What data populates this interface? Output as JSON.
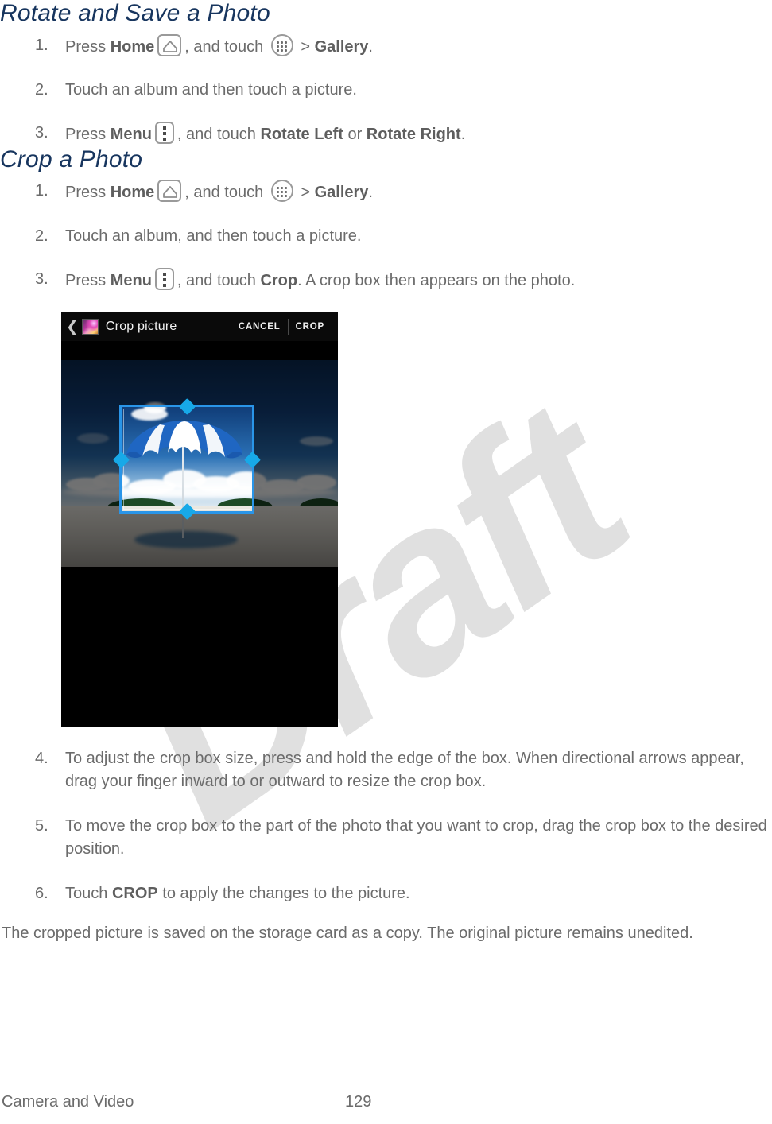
{
  "document": {
    "sections": [
      {
        "heading": "Rotate and Save a Photo",
        "steps": [
          {
            "num": "1.",
            "parts": [
              {
                "t": "text",
                "v": "Press "
              },
              {
                "t": "bold",
                "v": "Home"
              },
              {
                "t": "icon",
                "v": "home-icon"
              },
              {
                "t": "text",
                "v": ", and touch "
              },
              {
                "t": "icon",
                "v": "apps-grid-icon"
              },
              {
                "t": "text",
                "v": " > "
              },
              {
                "t": "bold",
                "v": "Gallery"
              },
              {
                "t": "text",
                "v": "."
              }
            ]
          },
          {
            "num": "2.",
            "parts": [
              {
                "t": "text",
                "v": "Touch an album and then touch a picture."
              }
            ]
          },
          {
            "num": "3.",
            "parts": [
              {
                "t": "text",
                "v": "Press "
              },
              {
                "t": "bold",
                "v": "Menu"
              },
              {
                "t": "icon",
                "v": "menu-overflow-icon"
              },
              {
                "t": "text",
                "v": ", and touch "
              },
              {
                "t": "bold",
                "v": "Rotate Left"
              },
              {
                "t": "text",
                "v": " or "
              },
              {
                "t": "bold",
                "v": "Rotate Right"
              },
              {
                "t": "text",
                "v": "."
              }
            ]
          }
        ]
      },
      {
        "heading": "Crop a Photo",
        "steps": [
          {
            "num": "1.",
            "parts": [
              {
                "t": "text",
                "v": "Press "
              },
              {
                "t": "bold",
                "v": "Home"
              },
              {
                "t": "icon",
                "v": "home-icon"
              },
              {
                "t": "text",
                "v": ", and touch "
              },
              {
                "t": "icon",
                "v": "apps-grid-icon"
              },
              {
                "t": "text",
                "v": " > "
              },
              {
                "t": "bold",
                "v": "Gallery"
              },
              {
                "t": "text",
                "v": "."
              }
            ]
          },
          {
            "num": "2.",
            "parts": [
              {
                "t": "text",
                "v": "Touch an album, and then touch a picture."
              }
            ]
          },
          {
            "num": "3.",
            "parts": [
              {
                "t": "text",
                "v": "Press "
              },
              {
                "t": "bold",
                "v": "Menu"
              },
              {
                "t": "icon",
                "v": "menu-overflow-icon"
              },
              {
                "t": "text",
                "v": ", and touch "
              },
              {
                "t": "bold",
                "v": "Crop"
              },
              {
                "t": "text",
                "v": ". A crop box then appears on the photo."
              }
            ]
          }
        ]
      }
    ],
    "steps_after_figure": [
      {
        "num": "4.",
        "parts": [
          {
            "t": "text",
            "v": "To adjust the crop box size, press and hold the edge of the box. When directional arrows appear, drag your finger inward to or outward to resize the crop box."
          }
        ]
      },
      {
        "num": "5.",
        "parts": [
          {
            "t": "text",
            "v": "To move the crop box to the part of the photo that you want to crop, drag the crop box to the desired position."
          }
        ]
      },
      {
        "num": "6.",
        "parts": [
          {
            "t": "text",
            "v": "Touch "
          },
          {
            "t": "bold",
            "v": "CROP"
          },
          {
            "t": "text",
            "v": " to apply the changes to the picture."
          }
        ]
      }
    ],
    "closing_paragraph": "The cropped picture is saved on the storage card as a copy. The original picture remains unedited."
  },
  "figure": {
    "alt": "Android Gallery crop picture screen",
    "actionbar": {
      "back_icon": "back-chevron-icon",
      "app_icon": "gallery-app-icon",
      "title": "Crop picture",
      "cancel_label": "CANCEL",
      "crop_label": "CROP"
    },
    "photo": {
      "description": "Beach scene with blue and white umbrella, clouds, island horizon and sand",
      "crop_handles": [
        "top",
        "right",
        "bottom",
        "left"
      ]
    },
    "colors": {
      "crop_box_border": "#2a95e8",
      "crop_handle": "#17a9e8",
      "actionbar_bg": "#0a0a0a",
      "figure_bg": "#000000"
    }
  },
  "watermark": {
    "text": "Draft",
    "color": "#e0e0e0"
  },
  "footer": {
    "chapter": "Camera and Video",
    "page_number": "129"
  },
  "theme": {
    "heading_color": "#17355e",
    "body_color": "#6b6b6b",
    "bold_color": "#5e5e5e",
    "page_bg": "#ffffff"
  }
}
